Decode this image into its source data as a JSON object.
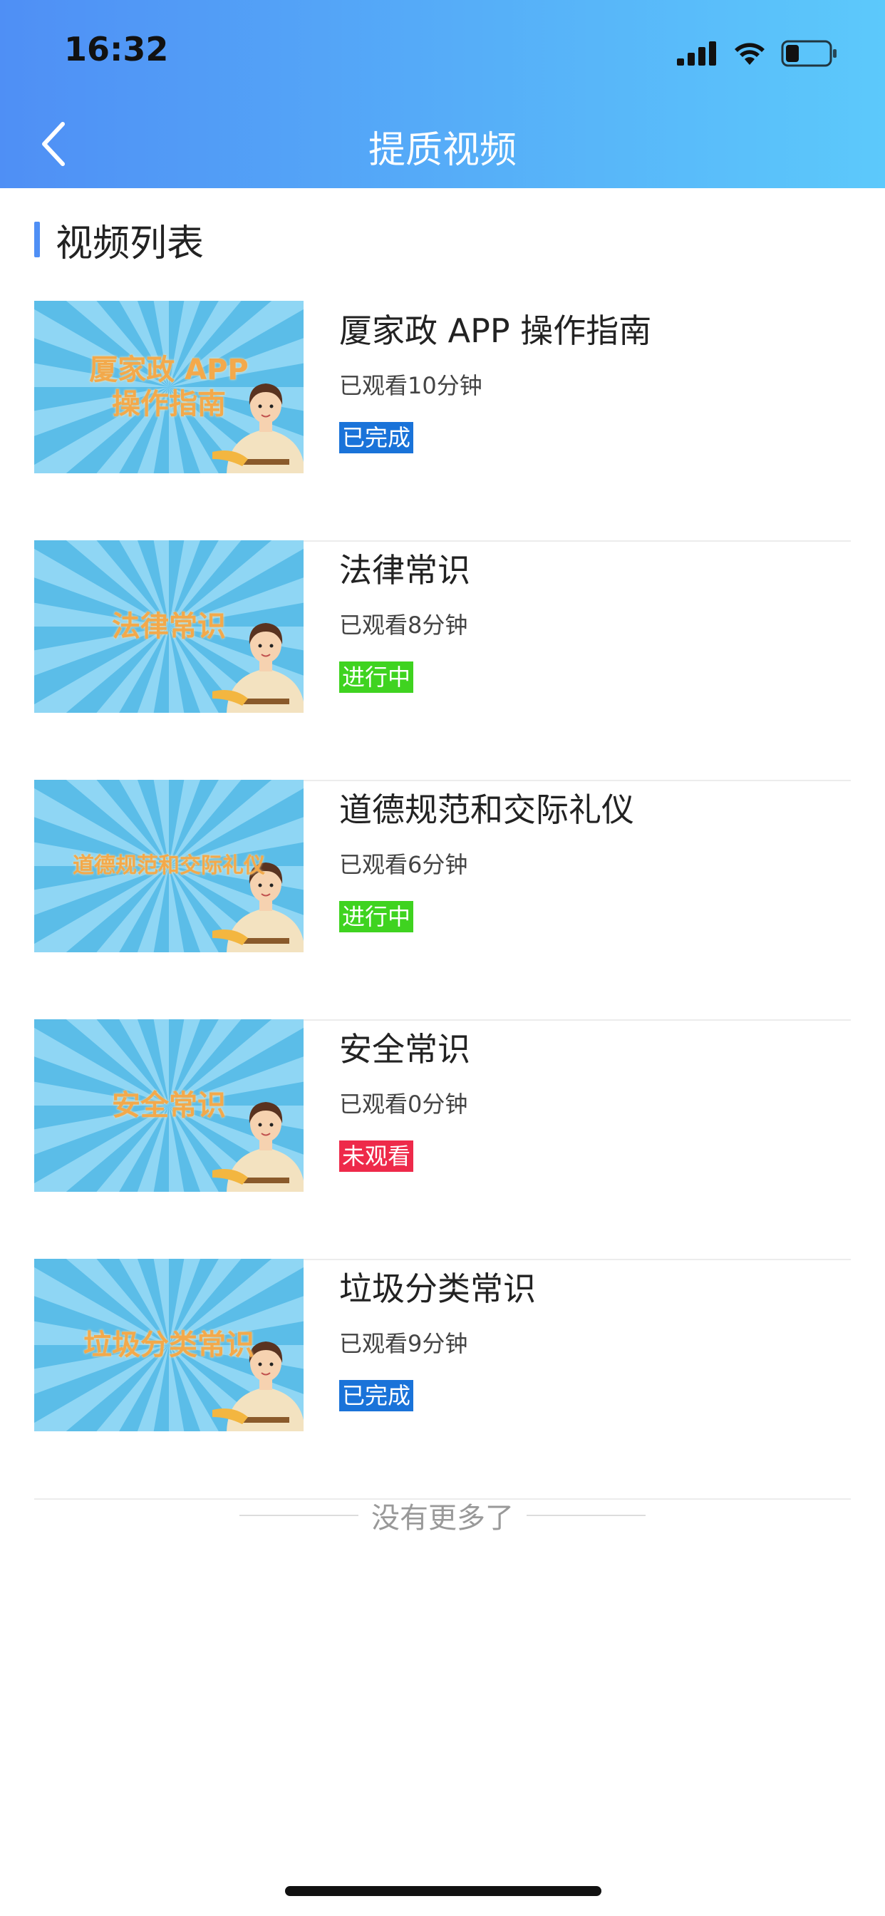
{
  "status_bar": {
    "time": "16:32"
  },
  "header": {
    "title": "提质视频"
  },
  "section": {
    "title": "视频列表"
  },
  "videos": [
    {
      "title": "厦家政 APP 操作指南",
      "thumb_line1": "厦家政 APP",
      "thumb_line2": "操作指南",
      "watched": "已观看10分钟",
      "status": "已完成",
      "status_color": "#1a73d9"
    },
    {
      "title": "法律常识",
      "thumb_line1": "法律常识",
      "thumb_line2": "",
      "watched": "已观看8分钟",
      "status": "进行中",
      "status_color": "#3fd320"
    },
    {
      "title": "道德规范和交际礼仪",
      "thumb_line1": "道德规范和交际礼仪",
      "thumb_line2": "",
      "watched": "已观看6分钟",
      "status": "进行中",
      "status_color": "#3fd320"
    },
    {
      "title": "安全常识",
      "thumb_line1": "安全常识",
      "thumb_line2": "",
      "watched": "已观看0分钟",
      "status": "未观看",
      "status_color": "#ee2a4a"
    },
    {
      "title": "垃圾分类常识",
      "thumb_line1": "垃圾分类常识",
      "thumb_line2": "",
      "watched": "已观看9分钟",
      "status": "已完成",
      "status_color": "#1a73d9"
    }
  ],
  "footer": {
    "no_more": "没有更多了"
  }
}
